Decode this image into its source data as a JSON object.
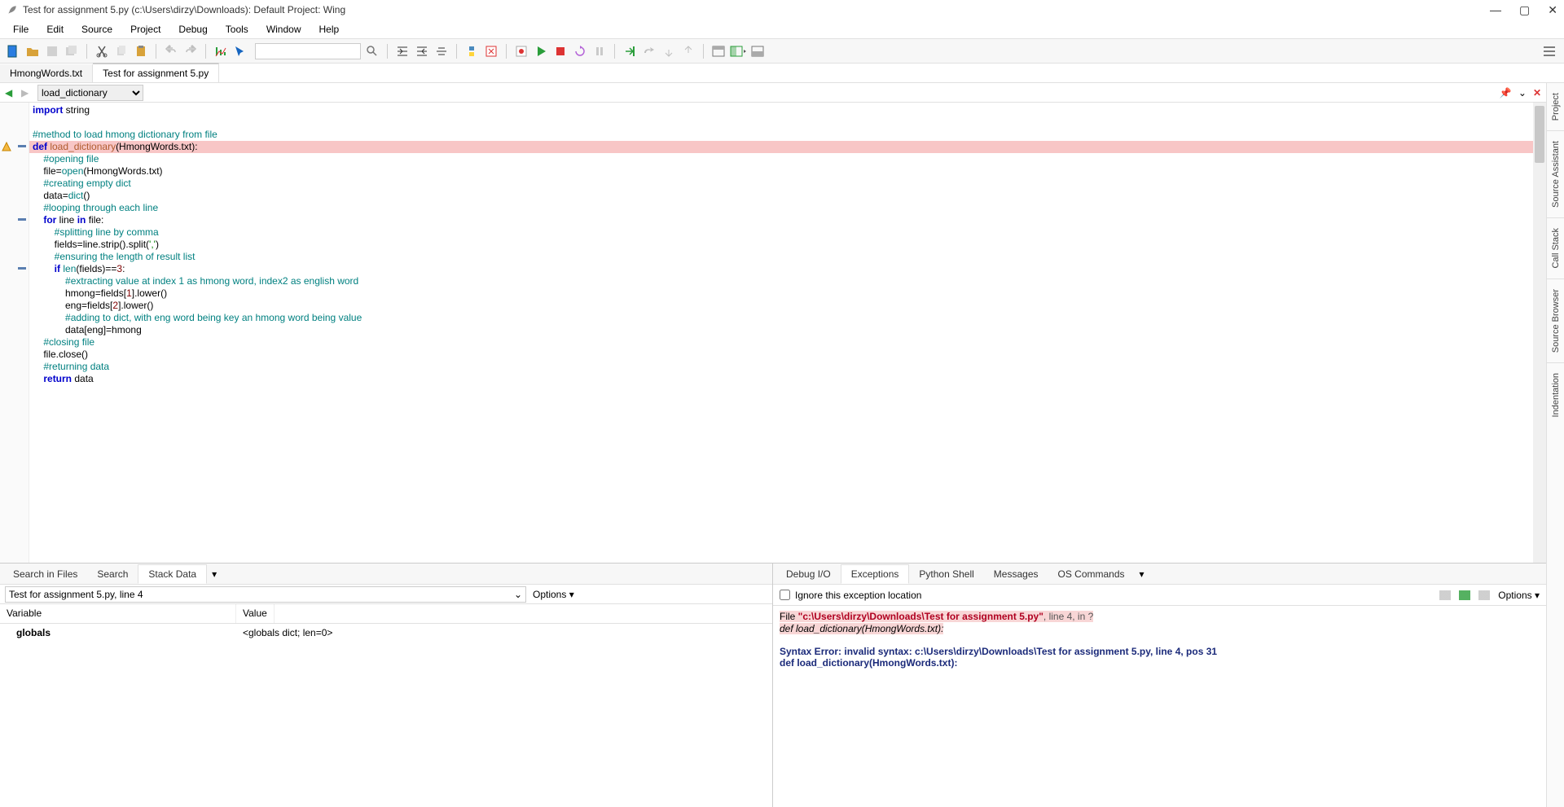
{
  "window": {
    "title": "Test for assignment 5.py (c:\\Users\\dirzy\\Downloads): Default Project: Wing"
  },
  "menu": [
    "File",
    "Edit",
    "Source",
    "Project",
    "Debug",
    "Tools",
    "Window",
    "Help"
  ],
  "file_tabs": [
    {
      "label": "HmongWords.txt",
      "active": false
    },
    {
      "label": "Test for assignment 5.py",
      "active": true
    }
  ],
  "symbol_selector": "load_dictionary",
  "code_lines": [
    {
      "html": "<span class='kw'>import</span> string",
      "fold": false,
      "err": false
    },
    {
      "html": "",
      "fold": false,
      "err": false
    },
    {
      "html": "<span class='cmt'>#method to load hmong dictionary from file</span>",
      "fold": false,
      "err": false
    },
    {
      "html": "<span class='kw'>def</span> <span class='def-name'>load_dictionary</span>(HmongWords.txt):",
      "fold": true,
      "err": true,
      "hl": true
    },
    {
      "html": "    <span class='cmt'>#opening file</span>",
      "fold": false,
      "err": false
    },
    {
      "html": "    file=<span class='builtin'>open</span>(HmongWords.txt)",
      "fold": false,
      "err": false
    },
    {
      "html": "    <span class='cmt'>#creating empty dict</span>",
      "fold": false,
      "err": false
    },
    {
      "html": "    data=<span class='builtin'>dict</span>()",
      "fold": false,
      "err": false
    },
    {
      "html": "    <span class='cmt'>#looping through each line</span>",
      "fold": false,
      "err": false
    },
    {
      "html": "    <span class='kw'>for</span> line <span class='kw'>in</span> file:",
      "fold": true,
      "err": false
    },
    {
      "html": "        <span class='cmt'>#splitting line by comma</span>",
      "fold": false,
      "err": false
    },
    {
      "html": "        fields=line.strip().split(<span class='str'>','</span>)",
      "fold": false,
      "err": false
    },
    {
      "html": "        <span class='cmt'>#ensuring the length of result list</span>",
      "fold": false,
      "err": false
    },
    {
      "html": "        <span class='kw'>if</span> <span class='builtin'>len</span>(fields)==<span class='num'>3</span>:",
      "fold": true,
      "err": false
    },
    {
      "html": "            <span class='cmt'>#extracting value at index 1 as hmong word, index2 as english word</span>",
      "fold": false,
      "err": false
    },
    {
      "html": "            hmong=fields[<span class='num'>1</span>].lower()",
      "fold": false,
      "err": false
    },
    {
      "html": "            eng=fields[<span class='num'>2</span>].lower()",
      "fold": false,
      "err": false
    },
    {
      "html": "            <span class='cmt'>#adding to dict, with eng word being key an hmong word being value</span>",
      "fold": false,
      "err": false
    },
    {
      "html": "            data[eng]=hmong",
      "fold": false,
      "err": false
    },
    {
      "html": "    <span class='cmt'>#closing file</span>",
      "fold": false,
      "err": false
    },
    {
      "html": "    file.close()",
      "fold": false,
      "err": false
    },
    {
      "html": "    <span class='cmt'>#returning data</span>",
      "fold": false,
      "err": false
    },
    {
      "html": "    <span class='kw'>return</span> data",
      "fold": false,
      "err": false
    }
  ],
  "left_panel": {
    "tabs": [
      "Search in Files",
      "Search",
      "Stack Data"
    ],
    "active_tab": "Stack Data",
    "location": "Test for assignment 5.py, line 4",
    "options_label": "Options",
    "columns": {
      "variable": "Variable",
      "value": "Value"
    },
    "rows": [
      {
        "variable": "globals",
        "value": "<globals dict; len=0>"
      }
    ]
  },
  "right_panel": {
    "tabs": [
      "Debug I/O",
      "Exceptions",
      "Python Shell",
      "Messages",
      "OS Commands"
    ],
    "active_tab": "Exceptions",
    "ignore_label": "Ignore this exception location",
    "options_label": "Options",
    "exception": {
      "file_prefix": "File ",
      "file_path": "\"c:\\Users\\dirzy\\Downloads\\Test for assignment 5.py\"",
      "file_suffix": ", line 4, in ?",
      "code_line": " def load_dictionary(HmongWords.txt):",
      "error_line1": "Syntax Error: invalid syntax: c:\\Users\\dirzy\\Downloads\\Test for assignment 5.py, line 4, pos 31",
      "error_line2": "def load_dictionary(HmongWords.txt):"
    }
  },
  "side_tabs": [
    "Project",
    "Source Assistant",
    "Call Stack",
    "Source Browser",
    "Indentation"
  ]
}
